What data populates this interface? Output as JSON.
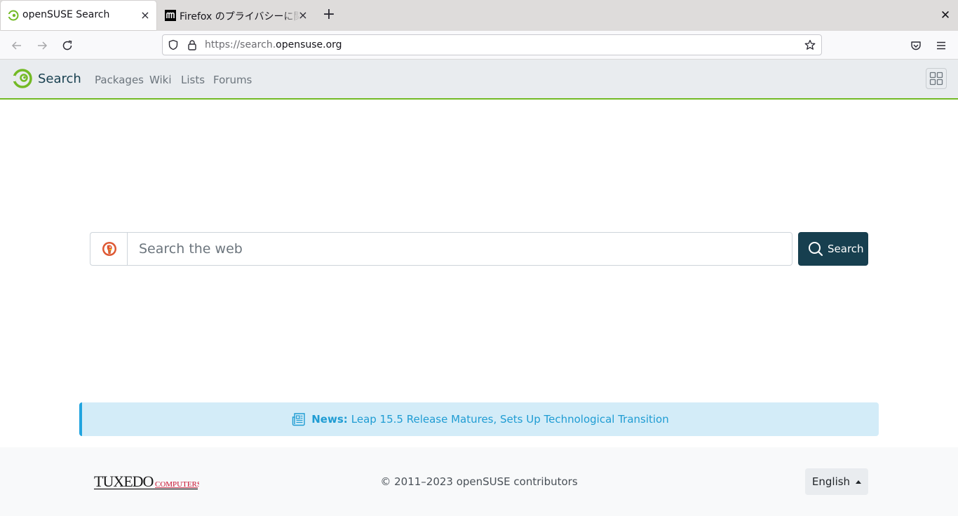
{
  "browser": {
    "tabs": [
      {
        "title": "openSUSE Search",
        "close": "×",
        "active": true
      },
      {
        "title": "Firefox のプライバシーに関",
        "close": "×",
        "active": false
      }
    ],
    "new_tab": "+",
    "window_close": "✕",
    "url_prefix": "https://search.",
    "url_domain": "opensuse.org"
  },
  "site": {
    "brand": "Search",
    "nav": [
      "Packages",
      "Wiki",
      "Lists",
      "Forums"
    ],
    "accent": "#73ba25",
    "primary": "#173f4f"
  },
  "search": {
    "placeholder": "Search the web",
    "button_label": "Search"
  },
  "news": {
    "label": "News:",
    "headline": "Leap 15.5 Release Matures, Sets Up Technological Transition"
  },
  "footer": {
    "sponsor_main": "TUXEDO",
    "sponsor_sub": "COMPUTERS",
    "copyright": "© 2011–2023 openSUSE contributors",
    "language": "English"
  }
}
